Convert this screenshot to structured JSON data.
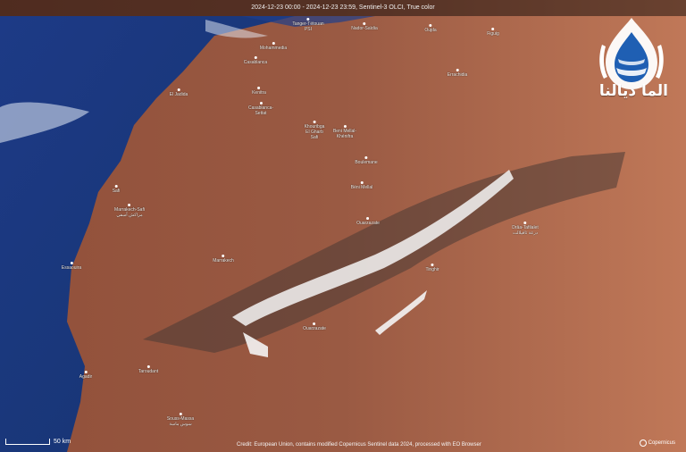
{
  "header": {
    "title": "2024-12-23 00:00 - 2024-12-23 23:59, Sentinel-3 OLCI, True color"
  },
  "footer": {
    "credit": "Credit: European Union, contains modified Copernicus Sentinel data 2024, processed with EO Browser",
    "scale_label": "50 km",
    "copernicus_label": "Copernicus"
  },
  "logo": {
    "text": "الما ديالنا"
  },
  "places": [
    {
      "label": "Tanger-Tétouan\nPSI"
    },
    {
      "label": "Nador-Saïdia"
    },
    {
      "label": "Oujda"
    },
    {
      "label": "Figuig"
    },
    {
      "label": "Mohammedia"
    },
    {
      "label": "Casablanca"
    },
    {
      "label": "El Jadida"
    },
    {
      "label": "Kenitra"
    },
    {
      "label": "Casablanca-\nSettat"
    },
    {
      "label": "Khouribga\nEl Gharb\nSafi"
    },
    {
      "label": "Beni Mellal-\nKhénifra"
    },
    {
      "label": "Errachidia"
    },
    {
      "label": "Safi"
    },
    {
      "label": "Boulemane"
    },
    {
      "label": "Béni Mellal"
    },
    {
      "label": "Marrakech-Safi\nمراكش آسفي"
    },
    {
      "label": "Ouarzazate"
    },
    {
      "label": "Essaouira"
    },
    {
      "label": "Marrakech"
    },
    {
      "label": "Tinghir"
    },
    {
      "label": "Drâa-Tafilalet\nدرعة تافيلالت"
    },
    {
      "label": "Ouarzazate"
    },
    {
      "label": "Agadir"
    },
    {
      "label": "Souss-Massa\nسوس ماسة"
    },
    {
      "label": "Taroudant"
    }
  ]
}
